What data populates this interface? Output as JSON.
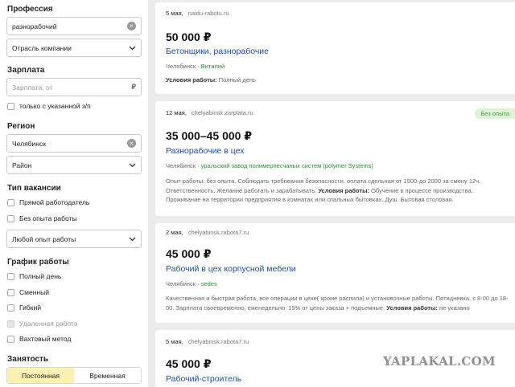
{
  "sidebar": {
    "profession": {
      "title": "Профессия",
      "value": "разнорабочий",
      "industry_select": "Отрасль компании"
    },
    "salary": {
      "title": "Зарплата",
      "placeholder": "Зарплата, от",
      "currency": "₽",
      "only_specified": "только с указанной з/п"
    },
    "region": {
      "title": "Регион",
      "value": "Челябинск",
      "district_select": "Район"
    },
    "vacancy_type": {
      "title": "Тип вакансии",
      "options": [
        "Прямой работодатель",
        "Без опыта работы"
      ],
      "experience_select": "Любой опыт работы"
    },
    "schedule": {
      "title": "График работы",
      "options": [
        {
          "label": "Полный день",
          "disabled": false
        },
        {
          "label": "Сменный",
          "disabled": false
        },
        {
          "label": "Гибкий",
          "disabled": false
        },
        {
          "label": "Удаленная работа",
          "disabled": true
        },
        {
          "label": "Вахтовый метод",
          "disabled": false
        }
      ]
    },
    "employment": {
      "title": "Занятость",
      "options": [
        "Постоянная",
        "Временная"
      ],
      "active": 0
    }
  },
  "jobs": [
    {
      "date": "5 мая,",
      "source": "naidu-rabotu.ru",
      "salary": "50 000 ₽",
      "title": "Бетонщики, разнорабочие",
      "city": "Челябинск",
      "employer": "Виталий",
      "conditions_label": "Условия работы:",
      "conditions": "Полный день"
    },
    {
      "date": "12 мая,",
      "source": "chelyabinsk.zarplata.ru",
      "badge": "Без опыта",
      "salary": "35 000–45 000 ₽",
      "title": "Разнорабочие в цех",
      "city": "Челябинск",
      "employer": "уральский завод полимерпесчаных систем (polymer Systems)",
      "desc_pre": "Опыт работы: без опыта. Соблюдать требования безопасности. оплата сдельная от 1500-до 2000 за смену 12ч. Ответственность. Желание работать и зарабатывать.",
      "conditions_label": "Условия работы:",
      "desc_post": "Обучение в процессе производства.. Проживание на территории предприятия в комнатах или спальных бытовках. Душ. Бытовая столовая."
    },
    {
      "date": "2 мая,",
      "source": "chelyabinsk.rabota7.ru",
      "salary": "45 000 ₽",
      "title": "Рабочий в цех корпусной мебели",
      "city": "Челябинск",
      "employer": "sedes",
      "desc_pre": "Качественная и быстрая работа, все операции в цехе( кроме распила) и установочные работы. Пятидневка, с 8-00 до 18-00. Зарплата своевременно, еженедельно: 15% от цены заказа + подъемные.",
      "conditions_label": "Условия работы:",
      "desc_post": "не указано"
    },
    {
      "date": "5 мая,",
      "source": "chelyabinsk.rabota7.ru",
      "salary": "45 000 ₽",
      "title": "Рабочий-строитель"
    }
  ],
  "watermark": "YAPLAKAL.COM"
}
